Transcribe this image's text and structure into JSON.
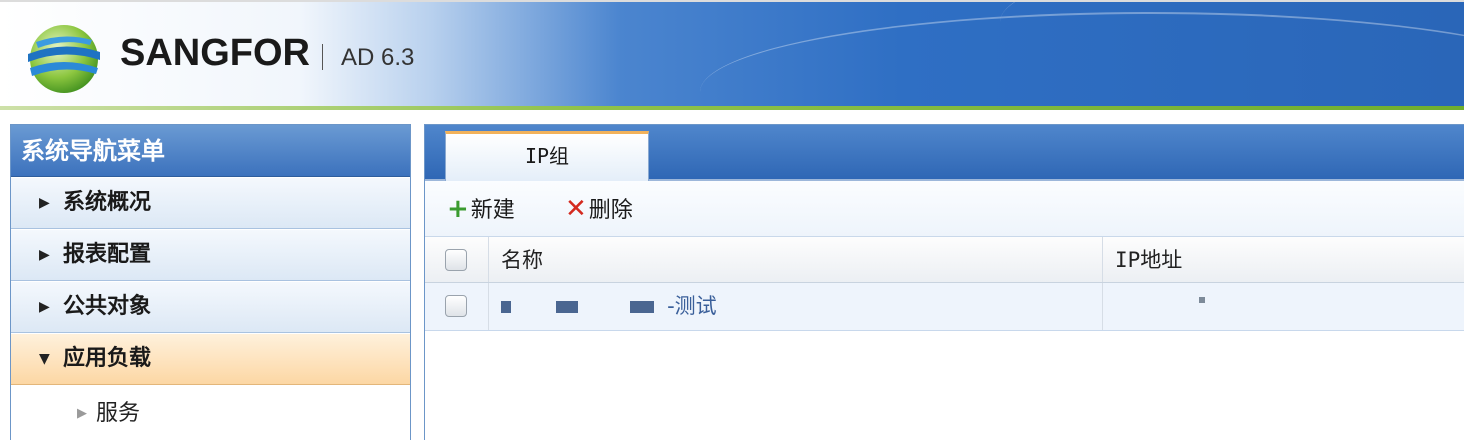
{
  "header": {
    "brand": "SANGFOR",
    "product": "AD 6.3",
    "colors": {
      "accent_blue": "#2f6fc4",
      "accent_green": "#8fc24a"
    }
  },
  "sidebar": {
    "title": "系统导航菜单",
    "items": [
      {
        "label": "系统概况",
        "expanded": false,
        "icon": "triangle-right-icon"
      },
      {
        "label": "报表配置",
        "expanded": false,
        "icon": "triangle-right-icon"
      },
      {
        "label": "公共对象",
        "expanded": false,
        "icon": "triangle-right-icon"
      },
      {
        "label": "应用负载",
        "expanded": true,
        "icon": "triangle-down-icon"
      }
    ],
    "sub_items": [
      {
        "label": "服务",
        "icon": "small-triangle-right-icon"
      }
    ]
  },
  "main": {
    "tabs": [
      {
        "label": "IP组",
        "active": true
      }
    ],
    "toolbar": {
      "new_label": "新建",
      "delete_label": "删除",
      "new_icon": "plus-icon",
      "delete_icon": "x-icon"
    },
    "table": {
      "columns": [
        "名称",
        "IP地址"
      ],
      "rows": [
        {
          "name_suffix": "-测试",
          "checked": false
        }
      ]
    }
  }
}
